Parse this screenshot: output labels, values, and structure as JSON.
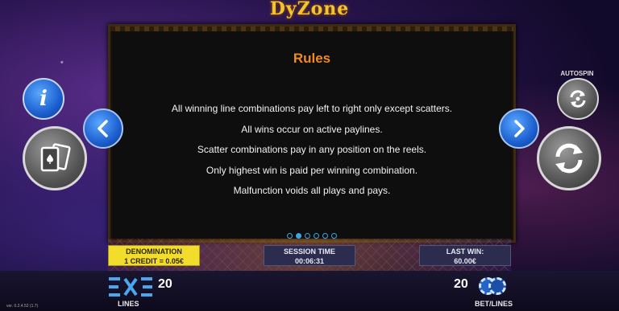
{
  "logo": "DyZone",
  "rules": {
    "title": "Rules",
    "lines": [
      "All winning line combinations pay left to right only except scatters.",
      "All wins occur on active paylines.",
      "Scatter combinations pay in any position on the reels.",
      "Only highest win is paid per winning combination.",
      "Malfunction voids all plays and pays."
    ],
    "page_count": 6,
    "active_page": 2
  },
  "buttons": {
    "info": "i",
    "prev": "‹",
    "next": "›",
    "autospin_label": "AUTOSPIN"
  },
  "status": {
    "denomination_label": "DENOMINATION",
    "denomination_value": "1 CREDIT = 0.05€",
    "session_label": "SESSION TIME",
    "session_value": "00:06:31",
    "lastwin_label": "LAST WIN:",
    "lastwin_value": "60.00€"
  },
  "bottom": {
    "lines_count": "20",
    "lines_label": "LINES",
    "bet_count": "20",
    "bet_label": "BET/LINES",
    "version": "ver. 0.2.4.52 (1.7)"
  },
  "colors": {
    "accent_blue": "#3aa7e6",
    "rules_title": "#f08a1c",
    "denom_bg": "#f2dd2c"
  },
  "icons": [
    "info-icon",
    "chevron-left-icon",
    "chevron-right-icon",
    "cards-icon",
    "autospin-icon",
    "spin-icon",
    "lines-icon",
    "chips-icon"
  ]
}
